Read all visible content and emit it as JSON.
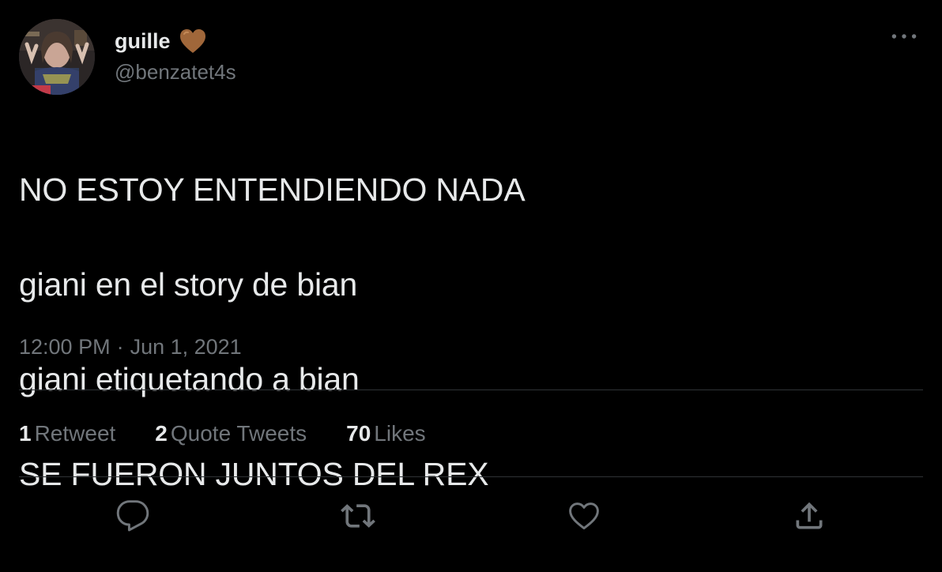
{
  "author": {
    "display_name": "guille",
    "handle": "@benzatet4s",
    "name_emoji": "brown-heart-icon",
    "emoji_color": "#a0673a"
  },
  "tweet": {
    "text_lines": [
      "NO ESTOY ENTENDIENDO NADA",
      "giani en el story de bian",
      "giani etiquetando a bian",
      "SE FUERON JUNTOS DEL REX"
    ],
    "time": "12:00 PM",
    "separator": "·",
    "date": "Jun 1, 2021"
  },
  "stats": {
    "retweets": {
      "count": "1",
      "label": "Retweet"
    },
    "quotes": {
      "count": "2",
      "label": "Quote Tweets"
    },
    "likes": {
      "count": "70",
      "label": "Likes"
    }
  },
  "actions": {
    "icons": [
      "reply-icon",
      "retweet-icon",
      "like-icon",
      "share-icon"
    ]
  },
  "colors": {
    "background": "#000000",
    "text_primary": "#e7e9ea",
    "text_secondary": "#71767b",
    "divider": "#2f3336"
  }
}
